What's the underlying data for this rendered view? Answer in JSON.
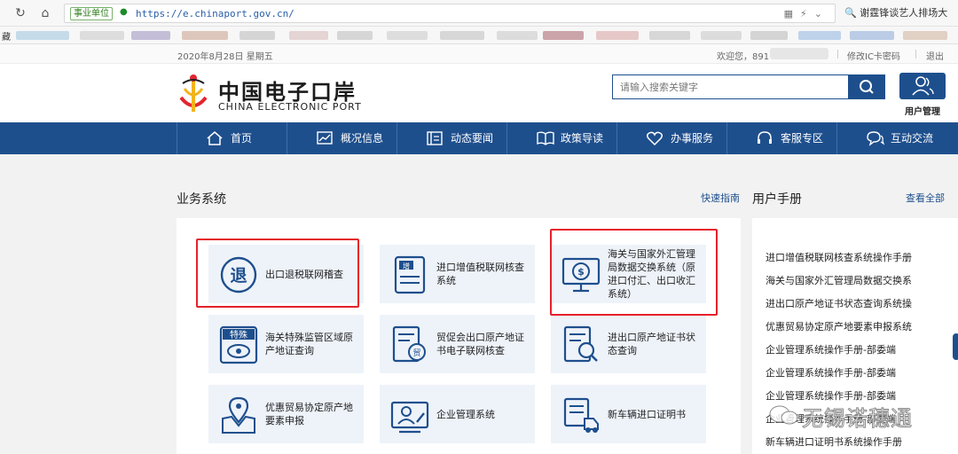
{
  "browser": {
    "url_badge": "事业单位",
    "url": "https://e.chinaport.gov.cn/",
    "search_text": "谢霆锋谈艺人排场大",
    "bookmark_label": "藏"
  },
  "topbar": {
    "date": "2020年8月28日 星期五",
    "welcome": "欢迎您，891",
    "modify_ic": "修改IC卡密码",
    "logout": "退出"
  },
  "header": {
    "logo_cn": "中国电子口岸",
    "logo_en": "CHINA ELECTRONIC PORT",
    "search_placeholder": "请输入搜索关键字",
    "user_label": "用户管理"
  },
  "nav": [
    "首页",
    "概况信息",
    "动态要闻",
    "政策导读",
    "办事服务",
    "客服专区",
    "互动交流"
  ],
  "business": {
    "title": "业务系统",
    "guide": "快速指南",
    "cards": [
      {
        "label": "出口退税联网稽查",
        "icon": "tui-icon"
      },
      {
        "label": "进口增值税联网核查系统",
        "icon": "zeng-icon"
      },
      {
        "label": "海关与国家外汇管理局数据交换系统（原进口付汇、出口收汇系统）",
        "icon": "exchange-monitor-icon"
      },
      {
        "label": "海关特殊监管区域原产地证查询",
        "icon": "teshu-icon"
      },
      {
        "label": "贸促会出口原产地证书电子联网核查",
        "icon": "certificate-check-icon"
      },
      {
        "label": "进出口原产地证书状态查询",
        "icon": "certificate-search-icon"
      },
      {
        "label": "优惠贸易协定原产地要素申报",
        "icon": "map-pin-icon"
      },
      {
        "label": "企业管理系统",
        "icon": "user-manage-icon"
      },
      {
        "label": "新车辆进口证明书",
        "icon": "truck-icon"
      }
    ],
    "highlight_color": "#e6212a"
  },
  "manual": {
    "title": "用户手册",
    "all": "查看全部",
    "items": [
      "进口增值税联网核查系统操作手册",
      "海关与国家外汇管理局数据交换系",
      "进出口原产地证书状态查询系统操",
      "优惠贸易协定原产地要素申报系统",
      "企业管理系统操作手册-部委端",
      "企业管理系统操作手册-部委端",
      "企业管理系统操作手册-部委端",
      "企业管理系统操作手册-部委端",
      "新车辆进口证明书系统操作手册"
    ]
  },
  "watermark": "无锡诺穗通",
  "colors": {
    "brand": "#1e4f8d",
    "card_bg": "#eef3fa"
  }
}
